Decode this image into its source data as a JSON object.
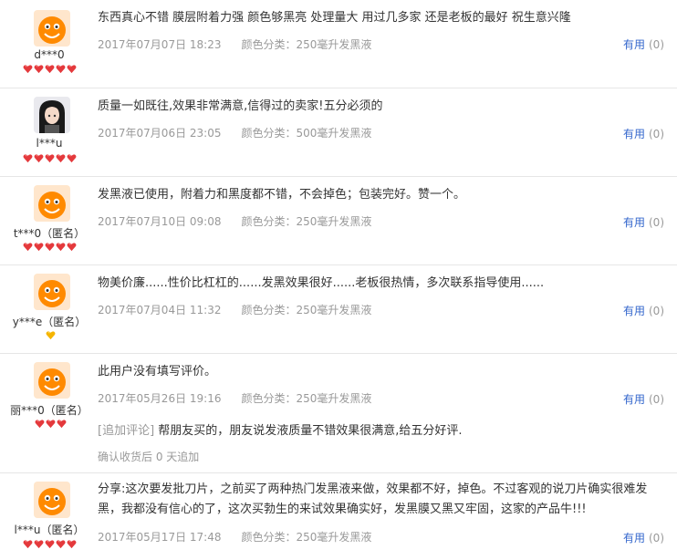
{
  "reviews": [
    {
      "user": "d***0",
      "rank_icon": "red-heart",
      "rank_count": 5,
      "avatar_style": "orange-default",
      "text": "东西真心不错 膜层附着力强 颜色够黑亮 处理量大 用过几多家 还是老板的最好 祝生意兴隆",
      "date": "2017年07月07日 18:23",
      "category": "颜色分类：250毫升发黑液",
      "useful_label": "有用",
      "useful_count": "(0)"
    },
    {
      "user": "l***u",
      "rank_icon": "red-heart",
      "rank_count": 5,
      "avatar_style": "photo-girl",
      "text": "质量一如既往,效果非常满意,信得过的卖家!五分必须的",
      "date": "2017年07月06日 23:05",
      "category": "颜色分类：500毫升发黑液",
      "useful_label": "有用",
      "useful_count": "(0)"
    },
    {
      "user": "t***0（匿名）",
      "rank_icon": "red-heart",
      "rank_count": 5,
      "avatar_style": "orange-default",
      "text": "发黑液已使用，附着力和黑度都不错，不会掉色；包装完好。赞一个。",
      "date": "2017年07月10日 09:08",
      "category": "颜色分类：250毫升发黑液",
      "useful_label": "有用",
      "useful_count": "(0)"
    },
    {
      "user": "y***e（匿名）",
      "rank_icon": "yellow-heart",
      "rank_count": 1,
      "avatar_style": "orange-default",
      "text": "物美价廉......性价比杠杠的......发黑效果很好......老板很热情，多次联系指导使用......",
      "date": "2017年07月04日 11:32",
      "category": "颜色分类：250毫升发黑液",
      "useful_label": "有用",
      "useful_count": "(0)"
    },
    {
      "user": "丽***0（匿名）",
      "rank_icon": "red-heart",
      "rank_count": 3,
      "avatar_style": "orange-default",
      "text": "此用户没有填写评价。",
      "date": "2017年05月26日 19:16",
      "category": "颜色分类：250毫升发黑液",
      "useful_label": "有用",
      "useful_count": "(0)",
      "append_tag": "[追加评论]",
      "append_text": " 帮朋友买的，朋友说发液质量不错效果很满意,给五分好评.",
      "append_meta": "确认收货后 0 天追加"
    },
    {
      "user": "l***u（匿名）",
      "rank_icon": "red-heart",
      "rank_count": 5,
      "avatar_style": "orange-default",
      "text": "分享:这次要发批刀片，之前买了两种热门发黑液来做，效果都不好，掉色。不过客观的说刀片确实很难发黑，我都没有信心的了，这次买勃生的来试效果确实好，发黑膜又黑又牢固，这家的产品牛!!!",
      "date": "2017年05月17日 17:48",
      "category": "颜色分类：250毫升发黑液",
      "useful_label": "有用",
      "useful_count": "(0)"
    }
  ]
}
